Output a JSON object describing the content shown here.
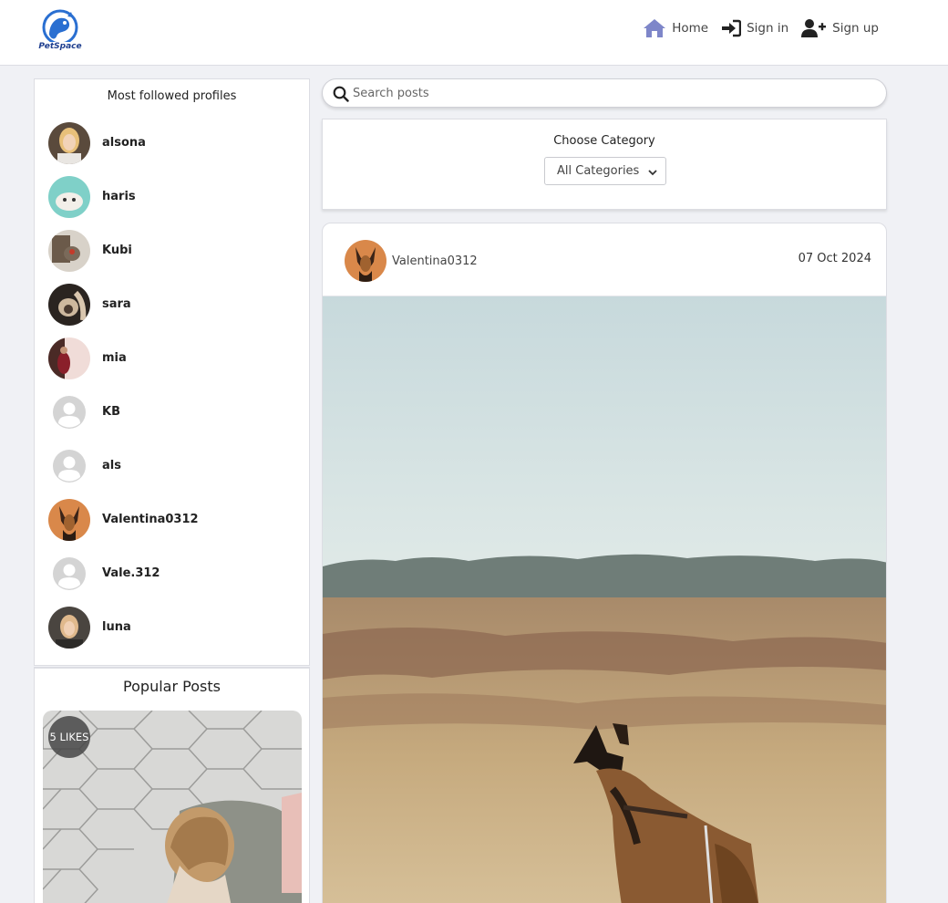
{
  "app": {
    "logo_text": "PetSpace"
  },
  "nav": {
    "home": "Home",
    "sign_in": "Sign in",
    "sign_up": "Sign up"
  },
  "sidebar": {
    "title": "Most followed profiles",
    "profiles": [
      {
        "name": "alsona",
        "avatar": "photo"
      },
      {
        "name": "haris",
        "avatar": "photo"
      },
      {
        "name": "Kubi",
        "avatar": "photo"
      },
      {
        "name": "sara",
        "avatar": "photo"
      },
      {
        "name": "mia",
        "avatar": "photo"
      },
      {
        "name": "KB",
        "avatar": "default-user-icon"
      },
      {
        "name": "als",
        "avatar": "default-user-icon"
      },
      {
        "name": "Valentina0312",
        "avatar": "photo"
      },
      {
        "name": "Vale.312",
        "avatar": "default-user-icon"
      },
      {
        "name": "luna",
        "avatar": "photo"
      }
    ]
  },
  "popular": {
    "title": "Popular Posts",
    "first_post_likes": "5 LIKES"
  },
  "search": {
    "placeholder": "Search posts"
  },
  "category": {
    "label": "Choose Category",
    "selected": "All Categories"
  },
  "post": {
    "author": "Valentina0312",
    "date": "07 Oct 2024"
  },
  "colors": {
    "page_bg": "#f0f1f5",
    "nav_home_icon": "#7e86c9",
    "logo_blue": "#2a6fd1"
  }
}
